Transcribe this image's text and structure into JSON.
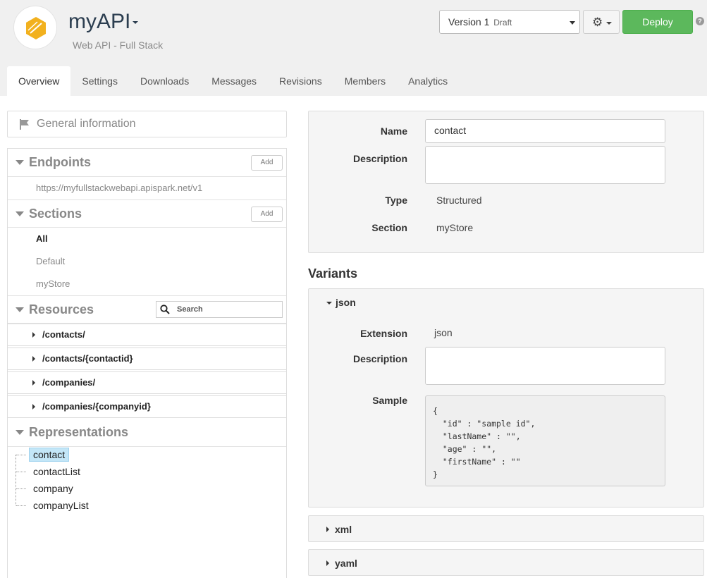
{
  "app": {
    "title": "myAPI",
    "subtitle": "Web API - Full Stack",
    "logo_icon": "hexagon-logo-icon",
    "version_label": "Version 1",
    "version_status": "Draft",
    "deploy_label": "Deploy",
    "help_label": "?",
    "brand_color": "#f2b11e",
    "deploy_color": "#5cb85c"
  },
  "tabs": [
    {
      "label": "Overview",
      "active": true
    },
    {
      "label": "Settings"
    },
    {
      "label": "Downloads"
    },
    {
      "label": "Messages"
    },
    {
      "label": "Revisions"
    },
    {
      "label": "Members"
    },
    {
      "label": "Analytics"
    }
  ],
  "sidebar": {
    "general_label": "General information",
    "endpoints": {
      "title": "Endpoints",
      "add_label": "Add",
      "items": [
        "https://myfullstackwebapi.apispark.net/v1"
      ]
    },
    "sections": {
      "title": "Sections",
      "add_label": "Add",
      "items": [
        "All",
        "Default",
        "myStore"
      ]
    },
    "resources": {
      "title": "Resources",
      "search_placeholder": "Search",
      "items": [
        "/contacts/",
        "/contacts/{contactid}",
        "/companies/",
        "/companies/{companyid}"
      ]
    },
    "representations": {
      "title": "Representations",
      "items": [
        "contact",
        "contactList",
        "company",
        "companyList"
      ],
      "selected": "contact"
    }
  },
  "form": {
    "name_label": "Name",
    "name_value": "contact",
    "description_label": "Description",
    "description_value": "",
    "type_label": "Type",
    "type_value": "Structured",
    "section_label": "Section",
    "section_value": "myStore"
  },
  "variants": {
    "title": "Variants",
    "json": {
      "label": "json",
      "extension_label": "Extension",
      "extension_value": "json",
      "description_label": "Description",
      "sample_label": "Sample",
      "sample_lines": [
        "{",
        "  \"id\" : \"sample id\",",
        "  \"lastName\" : \"\",",
        "  \"age\" : \"\",",
        "  \"firstName\" : \"\"",
        "}"
      ]
    },
    "xml_label": "xml",
    "yaml_label": "yaml"
  }
}
